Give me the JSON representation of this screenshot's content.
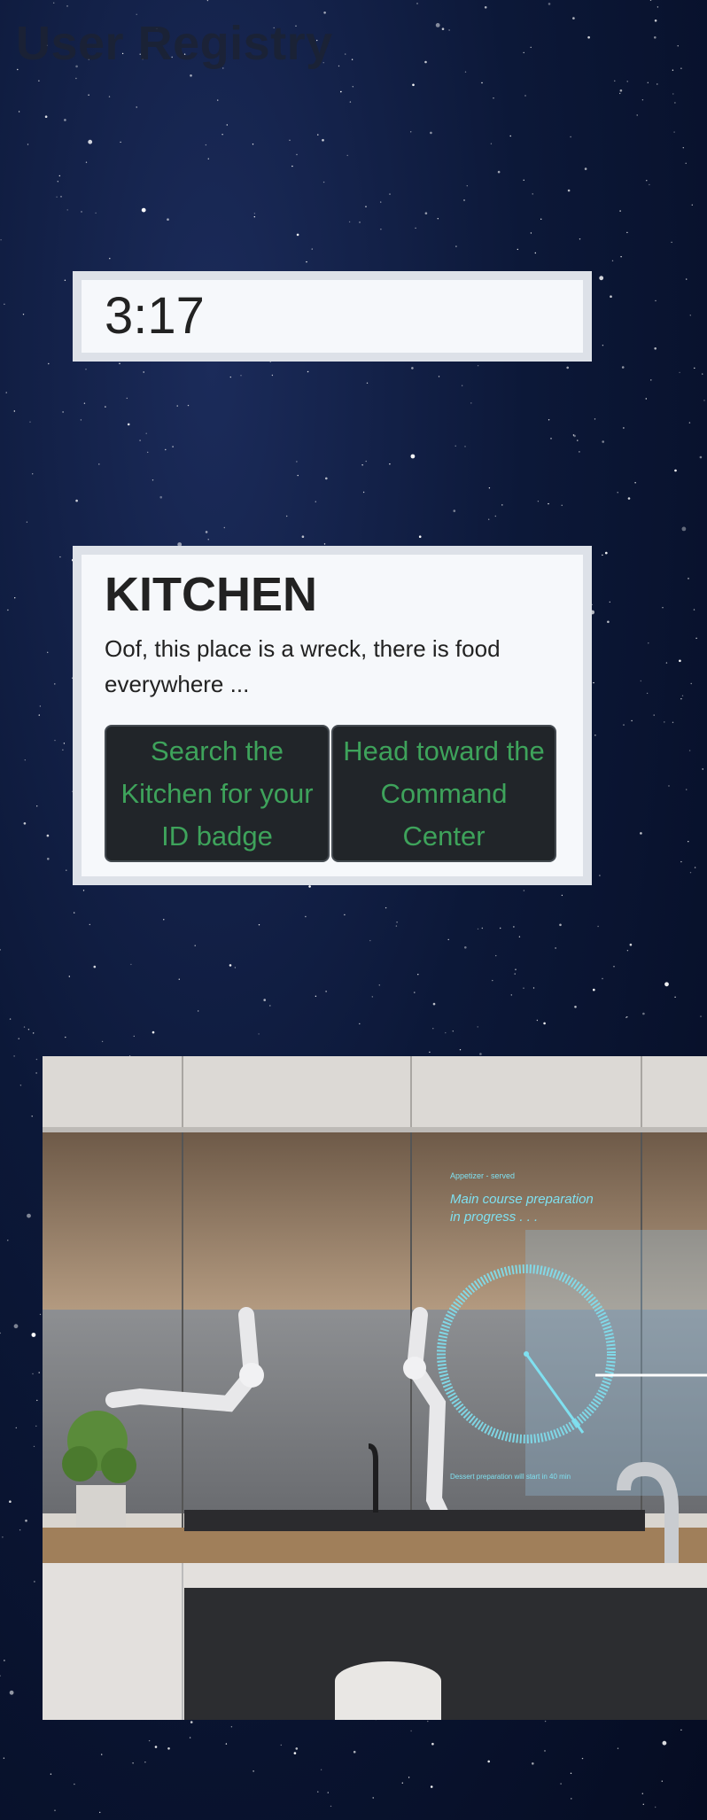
{
  "app": {
    "title": "User Registry"
  },
  "timer": {
    "value": "3:17"
  },
  "room": {
    "title": "KITCHEN",
    "description": "Oof, this place is a wreck, there is food everywhere ...",
    "actions": [
      {
        "label": "Search the Kitchen for your ID badge"
      },
      {
        "label": "Head toward the Command Center"
      }
    ]
  },
  "kitchen_display": {
    "status": "Appetizer - served",
    "main": "Main course preparation",
    "main_line2": "in progress . . .",
    "footer": "Dessert preparation will start in 40 min"
  },
  "colors": {
    "space_bg": "#0c1838",
    "card_bg": "#f6f8fb",
    "card_border": "#dde1e8",
    "button_bg": "#212529",
    "button_text": "#3ea35b",
    "hologram": "#7fe0f0"
  }
}
